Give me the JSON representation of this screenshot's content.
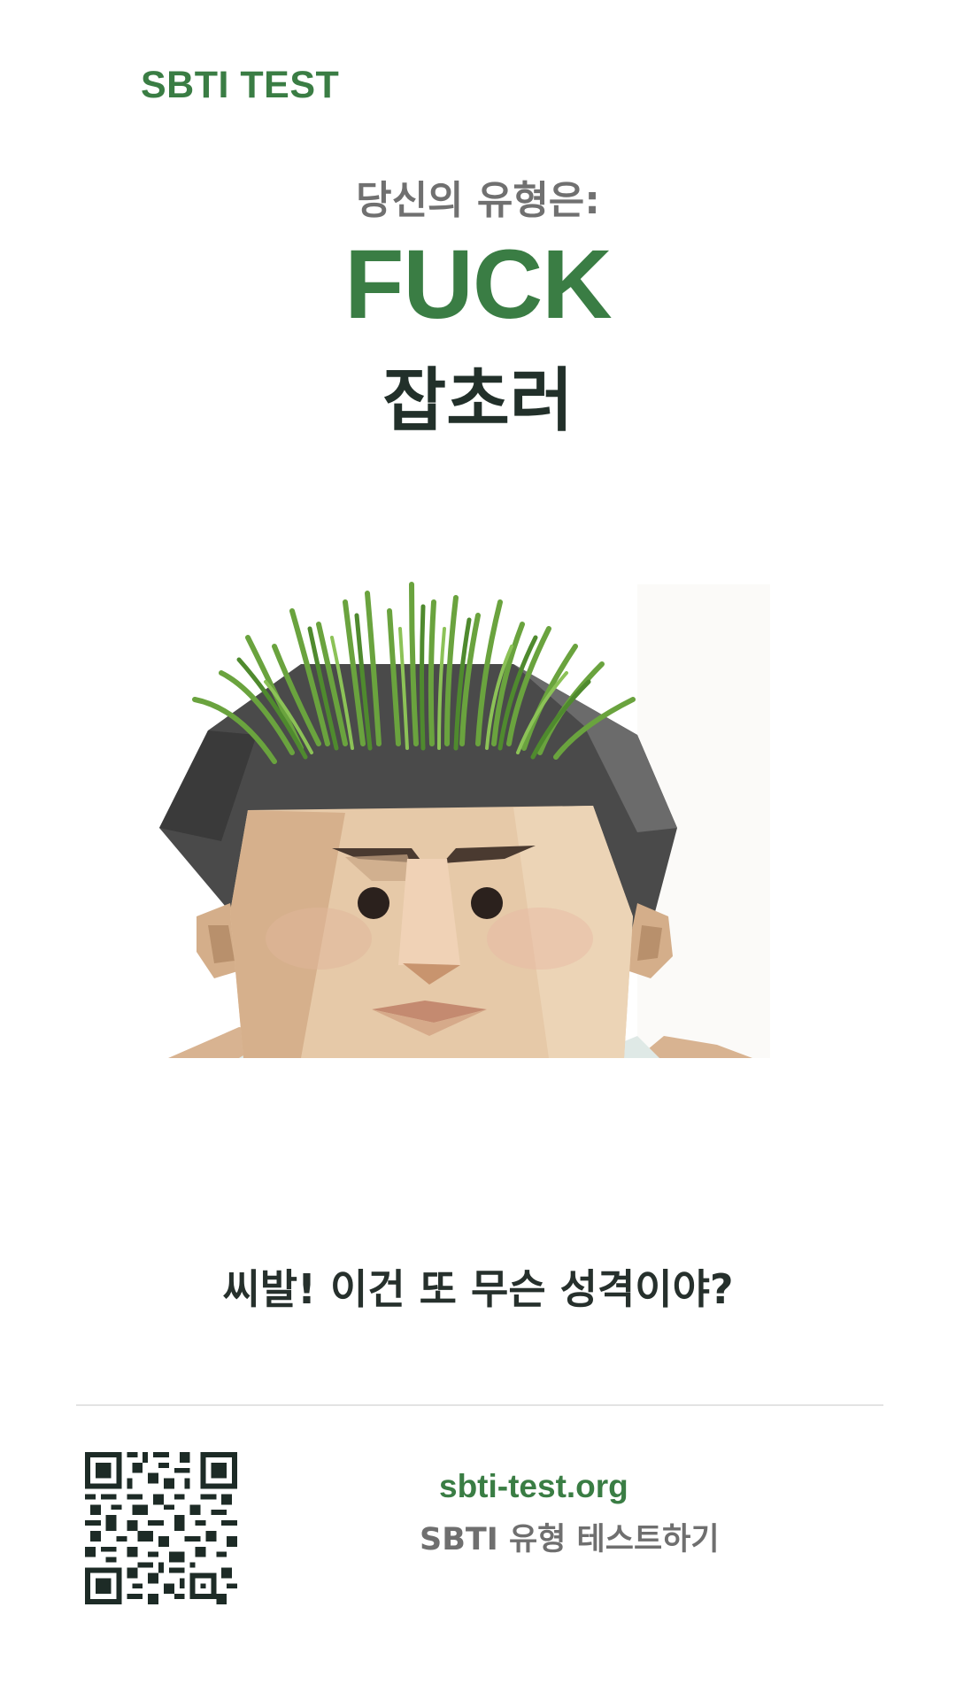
{
  "brand": {
    "title": "SBTI TEST"
  },
  "result": {
    "intro": "당신의 유형은:",
    "code": "FUCK",
    "name": "잡초러",
    "tagline": "씨발! 이건 또 무슨 성격이야?"
  },
  "footer": {
    "url": "sbti-test.org",
    "cta": "SBTI 유형 테스트하기"
  },
  "colors": {
    "accent": "#3a7d44",
    "text_dark": "#22302a",
    "text_muted": "#707070"
  }
}
